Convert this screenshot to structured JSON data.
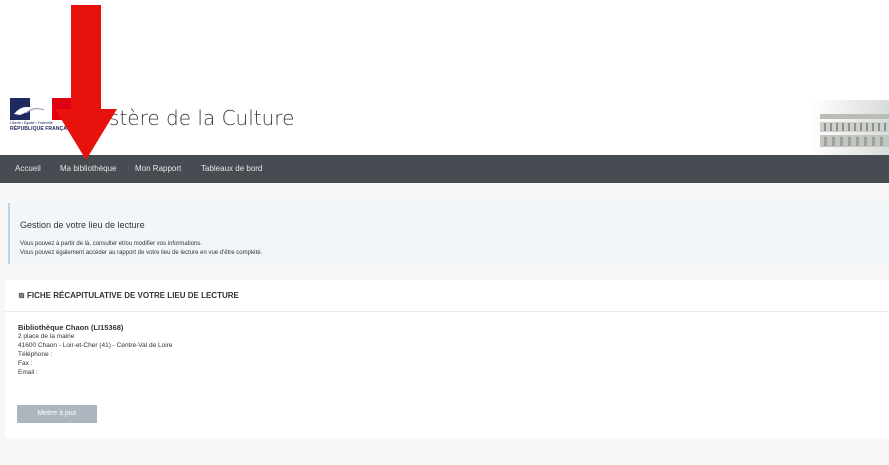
{
  "header": {
    "site_title": "Ministère de la Culture",
    "logo_line1": "Liberté • Égalité • Fraternité",
    "logo_line2": "RÉPUBLIQUE FRANÇAISE"
  },
  "nav": {
    "items": [
      {
        "label": "Accueil"
      },
      {
        "label": "Ma bibliothèque"
      },
      {
        "label": "Mon Rapport"
      },
      {
        "label": "Tableaux de bord"
      }
    ]
  },
  "info": {
    "title": "Gestion de votre lieu de lecture",
    "line1": "Vous pouvez à partir de là, consulter et/ou modifier vos informations.",
    "line2": "Vous pouvez également accéder au rapport de votre lieu de lecture en vue d'être complété."
  },
  "card": {
    "title": "FICHE RÉCAPITULATIVE DE VOTRE LIEU DE LECTURE",
    "library_name": "Bibliothèque Chaon (LI15368)",
    "address_line1": "2 place de la mairie",
    "address_line2": "41600 Chaon - Loir-et-Cher (41) - Centre-Val de Loire",
    "phone_label": "Téléphone :",
    "fax_label": "Fax :",
    "email_label": "Email :",
    "update_button": "Mettre à jour"
  },
  "colors": {
    "navbar": "#474c52",
    "arrow": "#e8120c",
    "button": "#adb5bf",
    "info_border": "#bcd2e8"
  }
}
